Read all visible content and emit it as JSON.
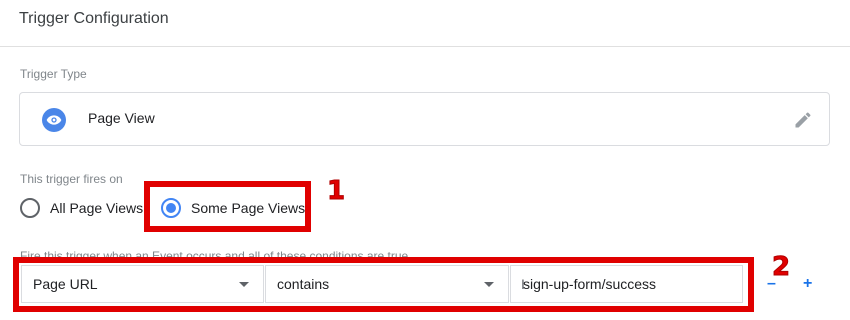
{
  "header": {
    "title": "Trigger Configuration"
  },
  "trigger_type": {
    "section_label": "Trigger Type",
    "icon": "eye-icon",
    "name": "Page View",
    "edit_icon": "pencil-icon"
  },
  "fires_on": {
    "section_label": "This trigger fires on",
    "options": [
      {
        "label": "All Page Views",
        "selected": false
      },
      {
        "label": "Some Page Views",
        "selected": true
      }
    ]
  },
  "conditions": {
    "section_label": "Fire this trigger when an Event occurs and all of these conditions are true",
    "variable": "Page URL",
    "operator": "contains",
    "value": "sign-up-form/success",
    "remove_label": "–",
    "add_label": "+"
  },
  "annotations": {
    "callout_1": "1",
    "callout_2": "2",
    "color": "#e00000"
  },
  "colors": {
    "accent": "#4285f4",
    "icon_blue": "#4a86e8"
  }
}
